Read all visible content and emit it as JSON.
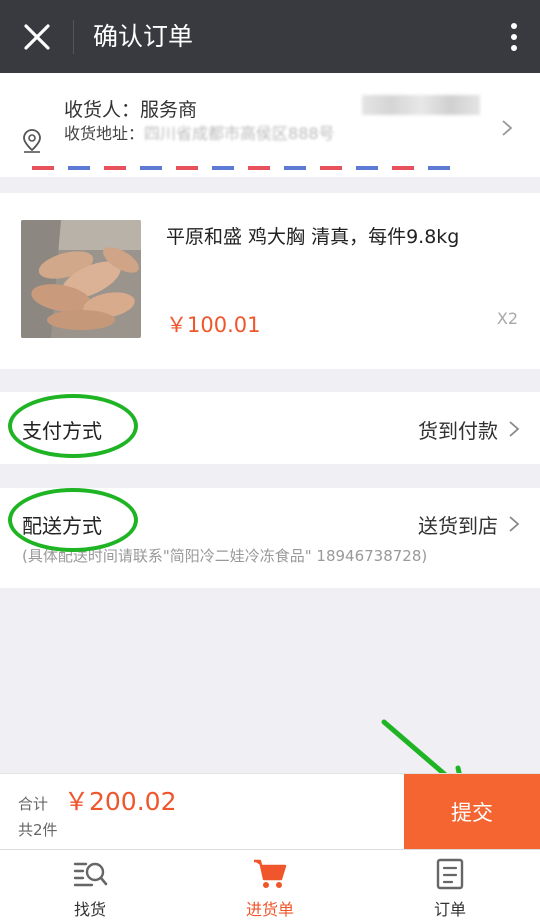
{
  "header": {
    "title": "确认订单",
    "close_icon": "close-icon",
    "more_icon": "more-vertical-icon"
  },
  "address": {
    "receiver": "收货人：服务商",
    "address_label": "收货地址：",
    "address_value": "四川省成都市高侯区888号",
    "location_icon": "location-pin-icon"
  },
  "product": {
    "name": "平原和盛 鸡大胸 清真，每件9.8kg",
    "price": "￥100.01",
    "quantity": "X2"
  },
  "payment": {
    "label": "支付方式",
    "value": "货到付款"
  },
  "delivery": {
    "label": "配送方式",
    "value": "送货到店",
    "note": "(具体配送时间请联系\"简阳冷二娃冷冻食品\" 18946738728)"
  },
  "summary": {
    "total_label": "合计",
    "total_value": "￥200.02",
    "count": "共2件",
    "submit_label": "提交"
  },
  "tabs": [
    {
      "label": "找货",
      "icon": "search-list-icon",
      "active": false
    },
    {
      "label": "进货单",
      "icon": "cart-icon",
      "active": true
    },
    {
      "label": "订单",
      "icon": "order-document-icon",
      "active": false
    }
  ],
  "colors": {
    "header_bg": "#393a3f",
    "accent": "#f0562b",
    "submit_bg": "#f46531",
    "annotation_green": "#1fb424",
    "airmail_red": "#e8505b",
    "airmail_blue": "#5b7bd4"
  }
}
